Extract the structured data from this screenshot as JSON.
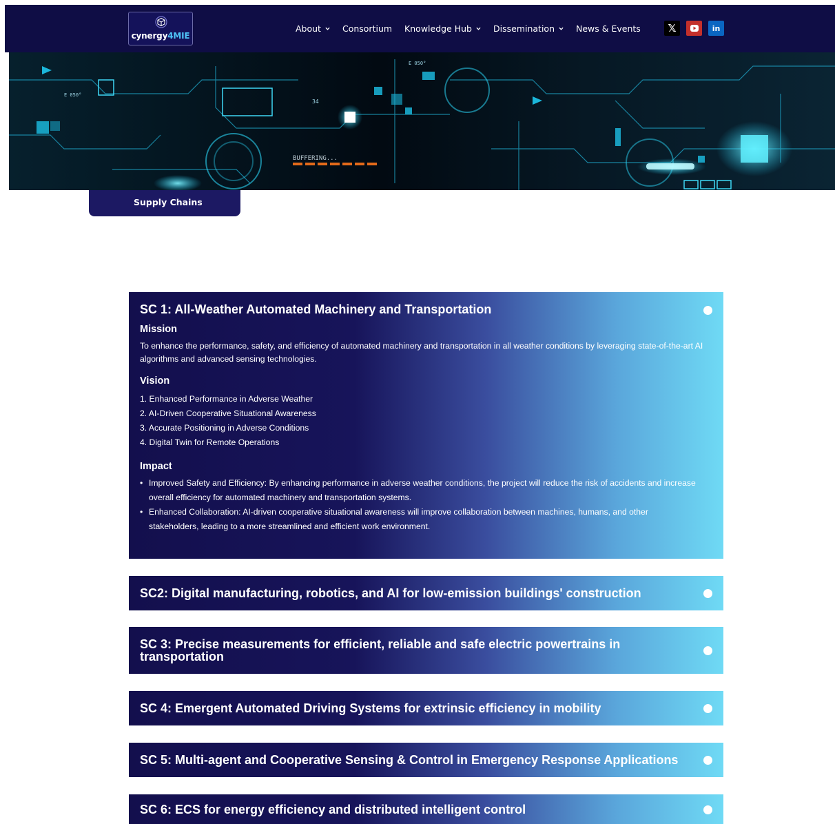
{
  "header": {
    "logo": {
      "prefix": "cynergy",
      "accent": "4MIE"
    },
    "nav": [
      {
        "label": "About",
        "dropdown": true
      },
      {
        "label": "Consortium",
        "dropdown": false
      },
      {
        "label": "Knowledge Hub",
        "dropdown": true
      },
      {
        "label": "Dissemination",
        "dropdown": true
      },
      {
        "label": "News & Events",
        "dropdown": false
      }
    ],
    "socials": [
      {
        "icon": "x-twitter-icon",
        "glyph": "𝕏",
        "color": "#000000"
      },
      {
        "icon": "youtube-icon",
        "glyph": "▶",
        "color": "#c4302b"
      },
      {
        "icon": "linkedin-icon",
        "glyph": "in",
        "color": "#0a66c2"
      }
    ]
  },
  "banner": {
    "labels": [
      "E 050°",
      "E 050°",
      "BUFFERING...",
      "34"
    ]
  },
  "page_tab": "Supply Chains",
  "accordions": [
    {
      "title": "SC 1: All-Weather Automated Machinery and Transportation",
      "expanded": true,
      "mission_heading": "Mission",
      "mission_text": "To enhance the performance, safety, and efficiency of automated machinery and transportation in all weather conditions by leveraging state-of-the-art AI algorithms and advanced sensing technologies.",
      "vision_heading": "Vision",
      "vision_items": [
        "1. Enhanced Performance in Adverse Weather",
        "2. AI-Driven Cooperative Situational Awareness",
        "3. Accurate Positioning in Adverse Conditions",
        "4. Digital Twin for Remote Operations"
      ],
      "impact_heading": "Impact",
      "impact_items": [
        "Improved Safety and Efficiency: By enhancing performance in adverse weather conditions, the project will reduce the risk of accidents and increase overall efficiency for automated machinery and transportation systems.",
        "Enhanced Collaboration: AI-driven cooperative situational awareness will improve collaboration between machines, humans, and other stakeholders, leading to a more streamlined and efficient work environment."
      ]
    },
    {
      "title": "SC2: Digital manufacturing, robotics, and AI for low-emission buildings' construction",
      "expanded": false
    },
    {
      "title": "SC 3: Precise measurements for efficient, reliable and safe electric powertrains in transportation",
      "expanded": false
    },
    {
      "title": "SC 4: Emergent Automated Driving Systems for extrinsic efficiency in mobility",
      "expanded": false
    },
    {
      "title": "SC 5: Multi-agent and Cooperative Sensing & Control in Emergency Response Applications",
      "expanded": false
    },
    {
      "title": "SC 6: ECS for energy efficiency and distributed intelligent control",
      "expanded": false
    }
  ],
  "colors": {
    "header_bg": "#0f0d45",
    "accordion_start": "#130f4d",
    "accordion_end": "#6fdaf5",
    "banner_glow": "#19c8ef"
  }
}
